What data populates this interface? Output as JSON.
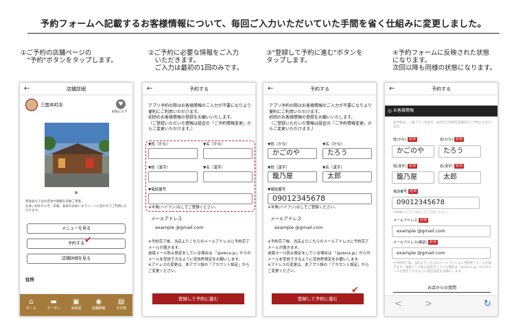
{
  "page": {
    "title": "予約フォームへ記載するお客様情報について、毎回ご入力いただいていた手間を省く仕組みに変更しました。"
  },
  "steps": [
    {
      "caption": "①ご予約の店舗ページの\n　\"予約\"ボタンをタップします。"
    },
    {
      "caption": "②ご予約に必要な情報をご入力\n　いただきます。\n　ご入力は最初の1回のみです。"
    },
    {
      "caption": "③\"登録して予約に進む\"ボタンを\nタップします。"
    },
    {
      "caption": "④予約フォームに反映された状態\nになります。\n次回以降も同様の状態になります。"
    }
  ],
  "phone1": {
    "header": "店舗詳細",
    "store_name": "三国本町店",
    "fav_label": "お気に入り",
    "description": "和食居なではの定食や御膳を多数ご用意。\nお食い初めや入学、卒業、長寿のお祝いまでシーンに合わせてご利用いただけます。",
    "menu_btn": "メニューを見る",
    "reserve_btn": "予約する",
    "info_btn": "店舗詳細を見る",
    "section": "住所",
    "nav": [
      {
        "icon": "⌂",
        "label": "ホーム"
      },
      {
        "icon": "▬",
        "label": "クーポン"
      },
      {
        "icon": "▣",
        "label": "会員証"
      },
      {
        "icon": "◉",
        "label": "店舗検索"
      },
      {
        "icon": "▤",
        "label": "その他"
      }
    ]
  },
  "form": {
    "header": "予約する",
    "intro": "アプリ予約の際はお客様情報のご入力が不要になりより便利にご利用いただけます。\n初回のお客様情報の登録をお願いいたします。\n（ご登録いただいた情報は設定の「ご予約情報変更」からご変更いただけます。）",
    "sei_kana": "▼姓（かな）",
    "mei_kana": "▼名（かな）",
    "sei_kanji": "▼姓（漢字）",
    "mei_kanji": "▼名（漢字）",
    "phone_label": "▼電話番号",
    "phone_note": "※半角(ハイフン)なしでご登録ください。",
    "email_label": "メールアドレス",
    "email_value": "example @gmail.com",
    "notes": "※予約完了後、当店よりこちらのメールアドレスに予約完了メールが届きます。\n迷惑メール防止設定をしている場合は 「@ebica.jp」からのメールを受信できるように受信許設定をお願いします。\n※アドレスの変更は、本アプリ設の「アカウント設定」からご変更ください。",
    "submit": "登録して予約に進む"
  },
  "filled": {
    "sei_kana": "かごのや",
    "mei_kana": "たろう",
    "sei_kanji": "籠乃屋",
    "mei_kanji": "太郎",
    "phone": "09012345678"
  },
  "phone4": {
    "header": "予約する",
    "banner": "お客様情報",
    "intro": "皆予約は、一部プランを除き、お店のご利用を説明日でご予約いただけます。",
    "sei_kana": "姓(かな)",
    "mei_kana": "名(かな)",
    "sei_kanji": "姓(漢字)",
    "mei_kanji": "名(漢字)",
    "phone_label": "電話番号",
    "required": "必須",
    "phone_note": "※半角(ハイフン)なしでご入力ください。",
    "email_label": "メールアドレス",
    "email_confirm_label": "メールアドレス(確認)",
    "email_value": "example @gmail.com",
    "notes": "※予約完了後、当店よりこちらのメールアドレスに予約完了メールが届きます。迷惑メール防止設定をしている場合は「@ebica.jp」からのメールを受信できるように受信設定をお願いします。",
    "question": "お店からの質問",
    "back": "<",
    "forward": ">",
    "reload": "↻"
  }
}
